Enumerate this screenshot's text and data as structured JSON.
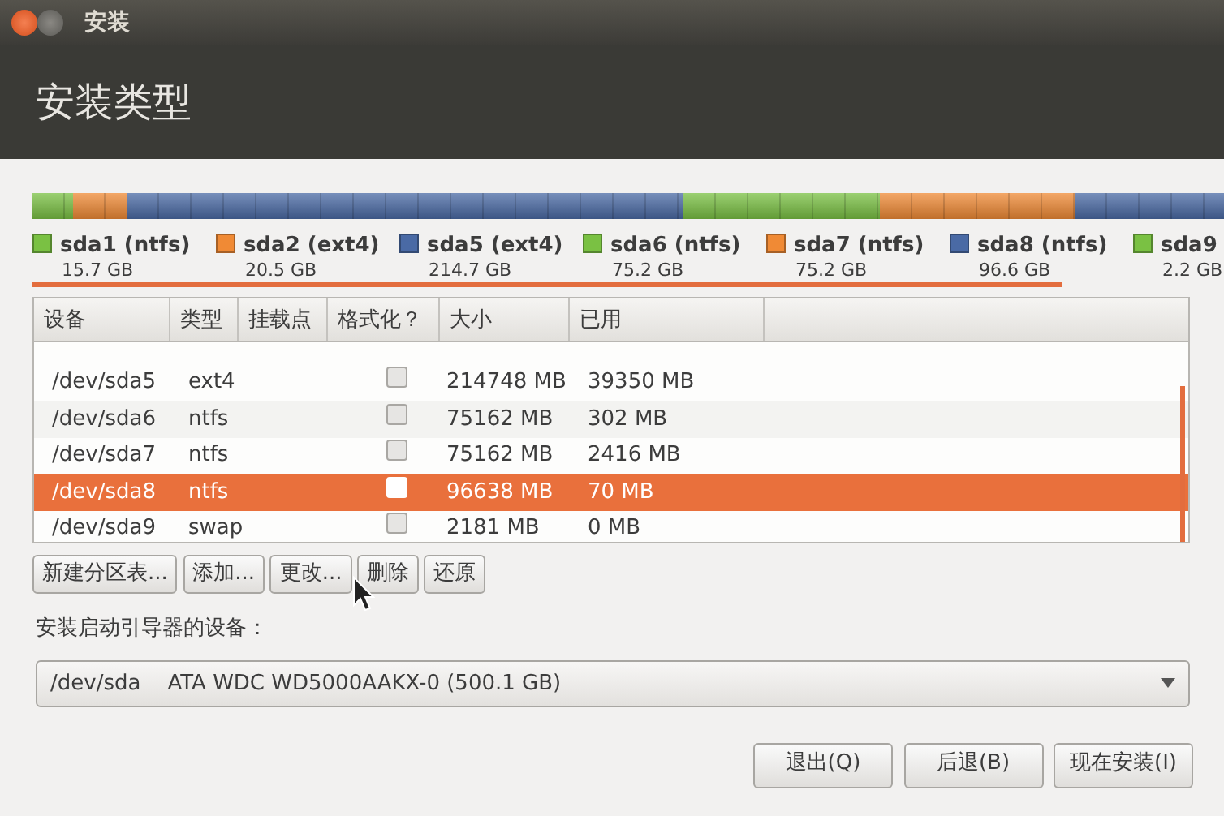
{
  "window": {
    "title": "安装"
  },
  "header": {
    "title": "安装类型"
  },
  "partitions": [
    {
      "name": "sda1 (ntfs)",
      "size": "15.7 GB",
      "color": "#7ac143"
    },
    {
      "name": "sda2 (ext4)",
      "size": "20.5 GB",
      "color": "#f08a35"
    },
    {
      "name": "sda5 (ext4)",
      "size": "214.7 GB",
      "color": "#4a6aa5"
    },
    {
      "name": "sda6 (ntfs)",
      "size": "75.2 GB",
      "color": "#7ac143"
    },
    {
      "name": "sda7 (ntfs)",
      "size": "75.2 GB",
      "color": "#f08a35"
    },
    {
      "name": "sda8 (ntfs)",
      "size": "96.6 GB",
      "color": "#4a6aa5"
    },
    {
      "name": "sda9",
      "size": "2.2 GB",
      "color": "#7ac143"
    }
  ],
  "table": {
    "columns": [
      "设备",
      "类型",
      "挂载点",
      "格式化？",
      "大小",
      "已用"
    ],
    "rows": [
      {
        "device": "/dev/sda5",
        "type": "ext4",
        "size": "214748 MB",
        "used": "39350 MB",
        "format": false,
        "selected": false
      },
      {
        "device": "/dev/sda6",
        "type": "ntfs",
        "size": "75162 MB",
        "used": "302 MB",
        "format": false,
        "selected": false
      },
      {
        "device": "/dev/sda7",
        "type": "ntfs",
        "size": "75162 MB",
        "used": "2416 MB",
        "format": false,
        "selected": false
      },
      {
        "device": "/dev/sda8",
        "type": "ntfs",
        "size": "96638 MB",
        "used": "70 MB",
        "format": false,
        "selected": true
      },
      {
        "device": "/dev/sda9",
        "type": "swap",
        "size": "2181 MB",
        "used": "0 MB",
        "format": false,
        "selected": false
      }
    ]
  },
  "table_buttons": [
    "新建分区表...",
    "添加...",
    "更改...",
    "删除",
    "还原"
  ],
  "bootloader": {
    "label": "安装启动引导器的设备：",
    "value": "/dev/sda    ATA WDC WD5000AAKX-0 (500.1 GB)"
  },
  "buttons": [
    "退出(Q)",
    "后退(B)",
    "现在安装(I)"
  ]
}
